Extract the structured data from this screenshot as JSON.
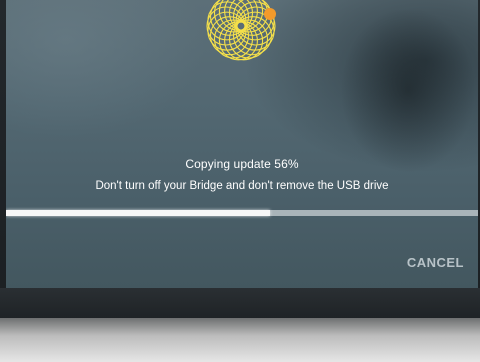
{
  "status": {
    "title": "Copying update 56%",
    "message": "Don't turn off your Bridge and don't remove the USB drive"
  },
  "progress": {
    "value": 0.56
  },
  "actions": {
    "cancel_label": "CANCEL"
  },
  "logo": {
    "icon": "spirograph-logo-icon",
    "color": "#f5e04a",
    "accent_color": "#f39a2b"
  }
}
